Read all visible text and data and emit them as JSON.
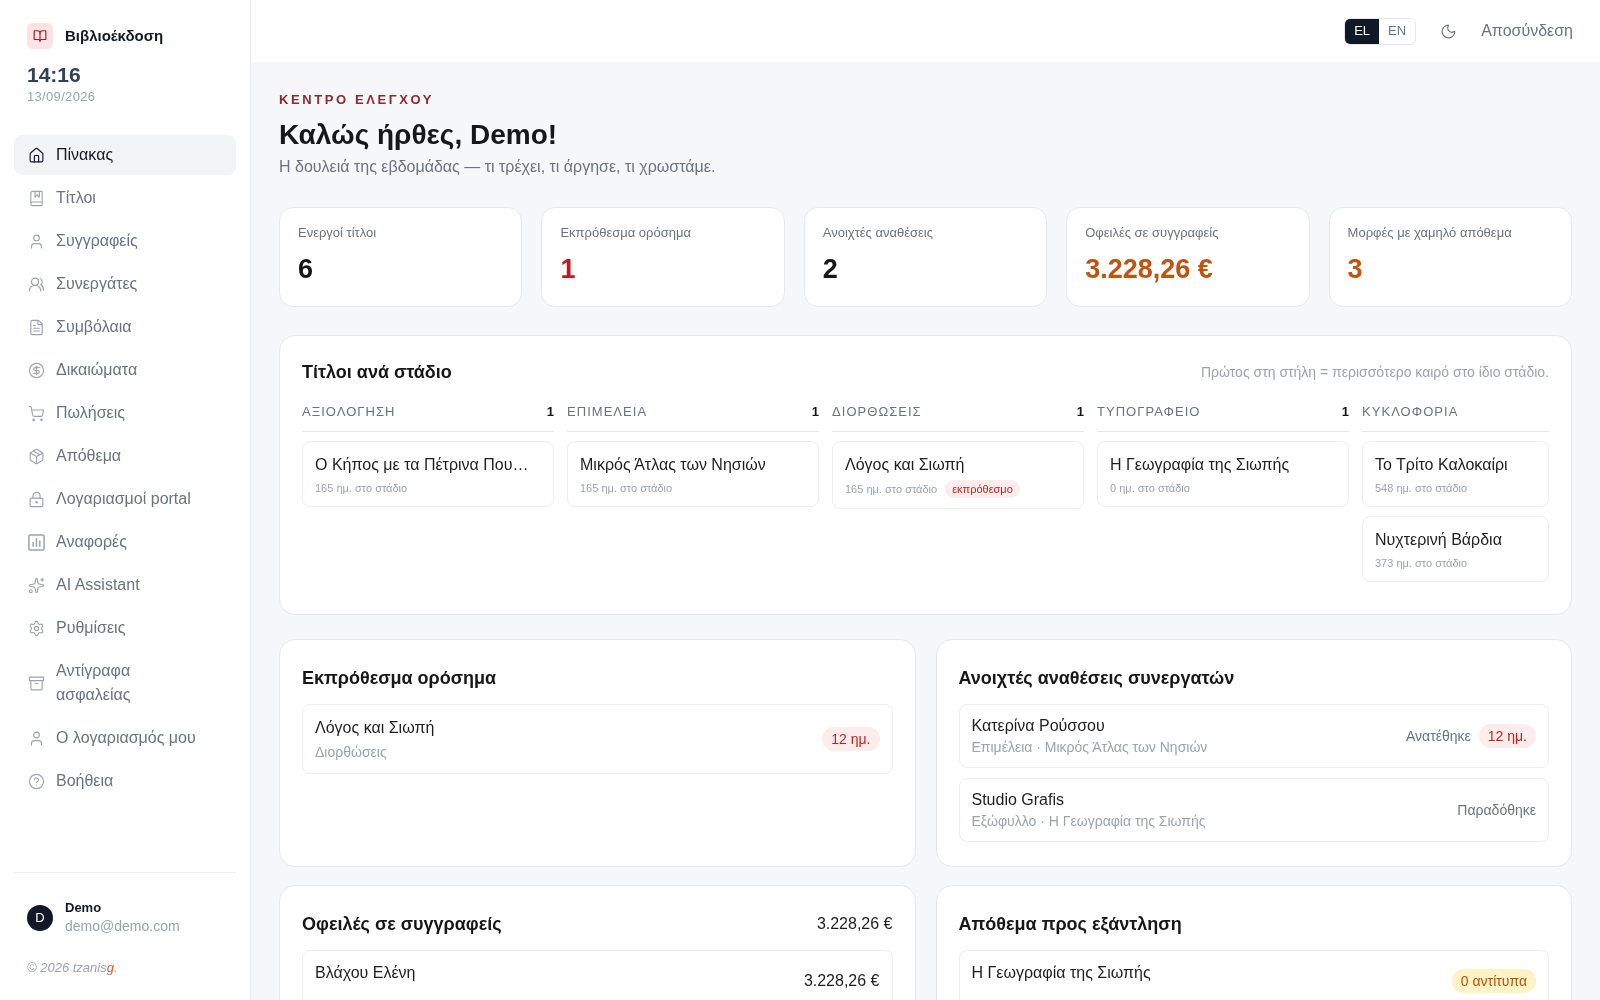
{
  "sidebar": {
    "brand": "Βιβλιοέκδοση",
    "time": "14:16",
    "date": "13/09/2026",
    "items": [
      {
        "label": "Πίνακας",
        "selected": true
      },
      {
        "label": "Τίτλοι",
        "selected": false
      },
      {
        "label": "Συγγραφείς",
        "selected": false
      },
      {
        "label": "Συνεργάτες",
        "selected": false
      },
      {
        "label": "Συμβόλαια",
        "selected": false
      },
      {
        "label": "Δικαιώματα",
        "selected": false
      },
      {
        "label": "Πωλήσεις",
        "selected": false
      },
      {
        "label": "Απόθεμα",
        "selected": false
      },
      {
        "label": "Λογαριασμοί portal",
        "selected": false
      },
      {
        "label": "Αναφορές",
        "selected": false
      },
      {
        "label": "AI Assistant",
        "selected": false
      },
      {
        "label": "Ρυθμίσεις",
        "selected": false
      },
      {
        "label": "Αντίγραφα ασφαλείας",
        "selected": false
      },
      {
        "label": "Ο λογαριασμός μου",
        "selected": false
      },
      {
        "label": "Βοήθεια",
        "selected": false
      }
    ],
    "user": {
      "initial": "D",
      "name": "Demo",
      "email": "demo@demo.com"
    },
    "footer": {
      "text": "© 2026 tzanis",
      "accent": "g",
      "end": "."
    }
  },
  "header": {
    "languages": [
      {
        "label": "EL",
        "selected": true
      },
      {
        "label": "EN",
        "selected": false
      }
    ],
    "logout": "Αποσύνδεση"
  },
  "page": {
    "eyebrow": "ΚΕΝΤΡΟ ΕΛΕΓΧΟΥ",
    "title": "Καλώς ήρθες, Demo!",
    "subtitle": "Η δουλειά της εβδομάδας — τι τρέχει, τι άργησε, τι χρωστάμε."
  },
  "stats": [
    {
      "label": "Ενεργοί τίτλοι",
      "value": "6",
      "color": "#171717"
    },
    {
      "label": "Εκπρόθεσμα ορόσημα",
      "value": "1",
      "color": "#d0101e"
    },
    {
      "label": "Ανοιχτές αναθέσεις",
      "value": "2",
      "color": "#171717"
    },
    {
      "label": "Οφειλές σε συγγραφείς",
      "value": "3.228,26 €",
      "color": "#c2530f"
    },
    {
      "label": "Μορφές με χαμηλό απόθεμα",
      "value": "3",
      "color": "#c2530f"
    }
  ],
  "pipeline": {
    "title": "Τίτλοι ανά στάδιο",
    "hint": "Πρώτος στη στήλη = περισσότερο καιρό στο ίδιο στάδιο.",
    "columns": [
      {
        "name": "ΑΞΙΟΛΟΓΗΣΗ",
        "count": "1",
        "cards": [
          {
            "title": "Ο Κήπος με τα Πέτρινα Που…",
            "meta": "165 ημ. στο στάδιο"
          }
        ]
      },
      {
        "name": "ΕΠΙΜΕΛΕΙΑ",
        "count": "1",
        "cards": [
          {
            "title": "Μικρός Άτλας των Νησιών",
            "meta": "165 ημ. στο στάδιο"
          }
        ]
      },
      {
        "name": "ΔΙΟΡΘΩΣΕΙΣ",
        "count": "1",
        "cards": [
          {
            "title": "Λόγος και Σιωπή",
            "meta": "165 ημ. στο στάδιο",
            "badge": "εκπρόθεσμο"
          }
        ]
      },
      {
        "name": "ΤΥΠΟΓΡΑΦΕΙΟ",
        "count": "1",
        "cards": [
          {
            "title": "Η Γεωγραφία της Σιωπής",
            "meta": "0 ημ. στο στάδιο"
          }
        ]
      },
      {
        "name": "ΚΥΚΛΟΦΟΡΙΑ",
        "cards": [
          {
            "title": "Το Τρίτο Καλοκαίρι",
            "meta": "548 ημ. στο στάδιο"
          },
          {
            "title": "Νυχτερινή Βάρδια",
            "meta": "373 ημ. στο στάδιο"
          }
        ]
      }
    ]
  },
  "overdue_milestones": {
    "title": "Εκπρόθεσμα ορόσημα",
    "rows": [
      {
        "title": "Λόγος και Σιωπή",
        "subtitle": "Διορθώσεις",
        "badge": "12 ημ."
      }
    ]
  },
  "open_assignments": {
    "title": "Ανοιχτές αναθέσεις συνεργατών",
    "rows": [
      {
        "name": "Κατερίνα Ρούσσου",
        "detail": "Επιμέλεια · Μικρός Άτλας των Νησιών",
        "status": "Ανατέθηκε",
        "badge": "12 ημ."
      },
      {
        "name": "Studio Grafis",
        "detail": "Εξώφυλλο · Η Γεωγραφία της Σιωπής",
        "status": "Παραδόθηκε"
      }
    ]
  },
  "author_payables": {
    "title": "Οφειλές σε συγγραφείς",
    "total": "3.228,26 €",
    "rows": [
      {
        "name": "Βλάχου Ελένη",
        "amount": "3.228,26 €"
      }
    ]
  },
  "low_stock": {
    "title": "Απόθεμα προς εξάντληση",
    "rows": [
      {
        "title": "Η Γεωγραφία της Σιωπής",
        "badge": "0 αντίτυπα"
      }
    ]
  }
}
